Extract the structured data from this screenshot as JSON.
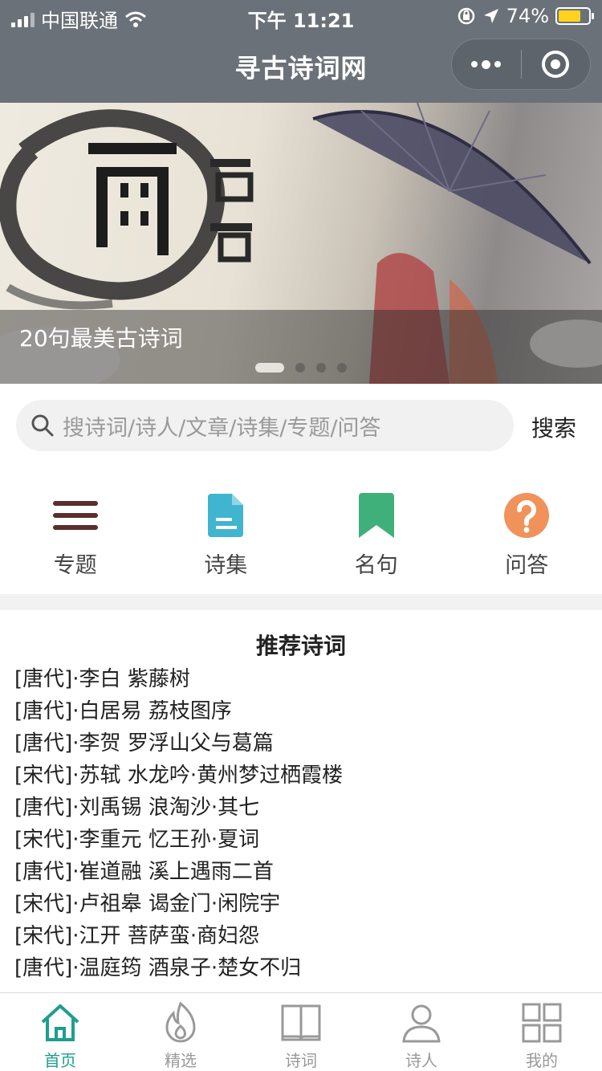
{
  "status_bar": {
    "carrier": "中国联通",
    "time": "下午 11:21",
    "battery": "74%",
    "battery_level": 0.74
  },
  "nav": {
    "title": "寻古诗词网",
    "more_icon": "more-dots-icon",
    "close_icon": "target-close-icon"
  },
  "banner": {
    "caption": "20句最美古诗词",
    "slide_count": 4,
    "active_index": 0
  },
  "search": {
    "placeholder": "搜诗词/诗人/文章/诗集/专题/问答",
    "button_label": "搜索",
    "icon": "search-icon"
  },
  "menu": [
    {
      "label": "专题",
      "icon": "list-icon",
      "color": "#5a2e2e"
    },
    {
      "label": "诗集",
      "icon": "document-icon",
      "color": "#3fb5cf"
    },
    {
      "label": "名句",
      "icon": "bookmark-icon",
      "color": "#3fb07a"
    },
    {
      "label": "问答",
      "icon": "question-icon",
      "color": "#f0925a"
    }
  ],
  "recommend": {
    "title": "推荐诗词",
    "items": [
      "[唐代]·李白 紫藤树",
      "[唐代]·白居易 荔枝图序",
      "[唐代]·李贺 罗浮山父与葛篇",
      "[宋代]·苏轼 水龙吟·黄州梦过栖霞楼",
      "[唐代]·刘禹锡 浪淘沙·其七",
      "[宋代]·李重元 忆王孙·夏词",
      "[唐代]·崔道融 溪上遇雨二首",
      "[宋代]·卢祖皋 谒金门·闲院宇",
      "[宋代]·江开 菩萨蛮·商妇怨",
      "[唐代]·温庭筠 酒泉子·楚女不归"
    ]
  },
  "tabbar": [
    {
      "label": "首页",
      "icon": "home-icon",
      "active": true
    },
    {
      "label": "精选",
      "icon": "flame-icon",
      "active": false
    },
    {
      "label": "诗词",
      "icon": "book-icon",
      "active": false
    },
    {
      "label": "诗人",
      "icon": "person-icon",
      "active": false
    },
    {
      "label": "我的",
      "icon": "grid-icon",
      "active": false
    }
  ],
  "colors": {
    "nav_bg": "#6b7178",
    "accent": "#1e9e8e",
    "battery": "#ffd21e"
  }
}
